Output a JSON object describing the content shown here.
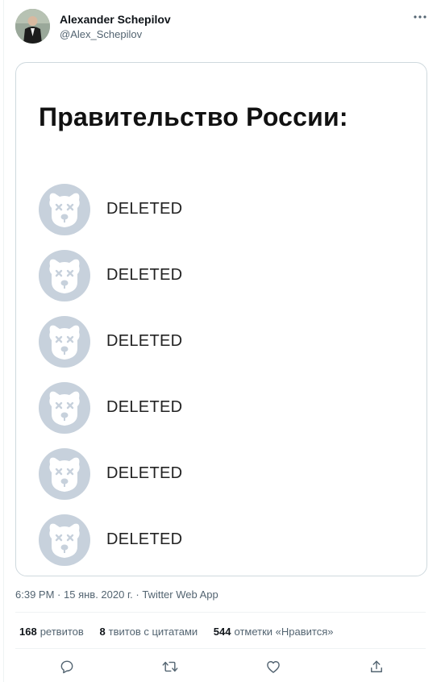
{
  "author": {
    "name": "Alexander Schepilov",
    "handle": "@Alex_Schepilov"
  },
  "media": {
    "title": "Правительство России:",
    "members": [
      {
        "label": "DELETED",
        "icon": "deleted-dog-avatar"
      },
      {
        "label": "DELETED",
        "icon": "deleted-dog-avatar"
      },
      {
        "label": "DELETED",
        "icon": "deleted-dog-avatar"
      },
      {
        "label": "DELETED",
        "icon": "deleted-dog-avatar"
      },
      {
        "label": "DELETED",
        "icon": "deleted-dog-avatar"
      },
      {
        "label": "DELETED",
        "icon": "deleted-dog-avatar"
      }
    ]
  },
  "meta": {
    "time": "6:39 PM",
    "separator": "·",
    "date": "15 янв. 2020 г.",
    "source": "Twitter Web App"
  },
  "stats": {
    "retweets_count": "168",
    "retweets_label": "ретвитов",
    "quotes_count": "8",
    "quotes_label": "твитов с цитатами",
    "likes_count": "544",
    "likes_label": "отметки «Нравится»"
  },
  "actions": [
    "reply-icon",
    "retweet-icon",
    "like-icon",
    "share-icon"
  ],
  "colors": {
    "text": "#0f1419",
    "muted": "#536471",
    "border": "#cfd9de",
    "icon": "#536471",
    "avatar_bg": "#c7d1dc"
  }
}
